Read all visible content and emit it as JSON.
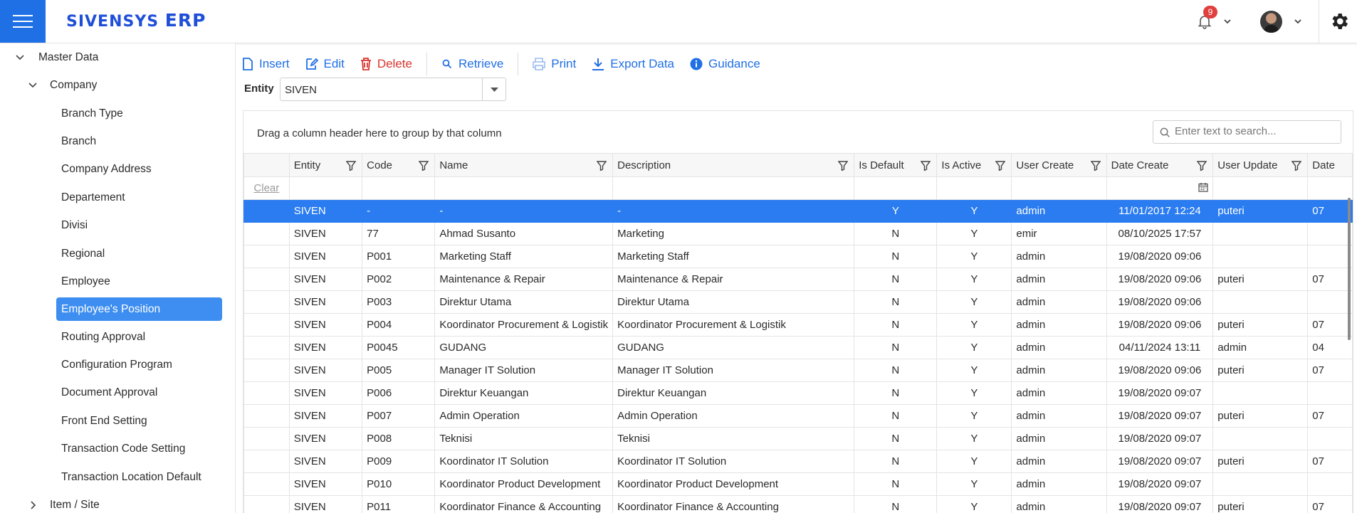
{
  "app": {
    "brand_main": "SIVENSYS",
    "brand_suffix": "ERP",
    "notification_count": "9"
  },
  "sidebar": {
    "items": [
      {
        "label": "Master Data",
        "level": 0,
        "expanded": true
      },
      {
        "label": "Company",
        "level": 1,
        "expanded": true
      },
      {
        "label": "Branch Type",
        "level": 2
      },
      {
        "label": "Branch",
        "level": 2
      },
      {
        "label": "Company Address",
        "level": 2
      },
      {
        "label": "Departement",
        "level": 2
      },
      {
        "label": "Divisi",
        "level": 2
      },
      {
        "label": "Regional",
        "level": 2
      },
      {
        "label": "Employee",
        "level": 2
      },
      {
        "label": "Employee's Position",
        "level": 2,
        "active": true
      },
      {
        "label": "Routing Approval",
        "level": 2
      },
      {
        "label": "Configuration Program",
        "level": 2
      },
      {
        "label": "Document Approval",
        "level": 2
      },
      {
        "label": "Front End Setting",
        "level": 2
      },
      {
        "label": "Transaction Code Setting",
        "level": 2
      },
      {
        "label": "Transaction Location Default",
        "level": 2
      },
      {
        "label": "Item / Site",
        "level": 1,
        "expanded": false
      }
    ]
  },
  "toolbar": {
    "insert": "Insert",
    "edit": "Edit",
    "delete": "Delete",
    "retrieve": "Retrieve",
    "print": "Print",
    "export": "Export Data",
    "guidance": "Guidance"
  },
  "entity": {
    "label": "Entity",
    "value": "SIVEN"
  },
  "grid": {
    "group_hint": "Drag a column header here to group by that column",
    "search_placeholder": "Enter text to search...",
    "clear_label": "Clear",
    "columns": [
      "Entity",
      "Code",
      "Name",
      "Description",
      "Is Default",
      "Is Active",
      "User Create",
      "Date Create",
      "User Update",
      "Date"
    ],
    "rows": [
      [
        "SIVEN",
        "-",
        "-",
        "-",
        "Y",
        "Y",
        "admin",
        "11/01/2017 12:24",
        "puteri",
        "07"
      ],
      [
        "SIVEN",
        "77",
        "Ahmad Susanto",
        "Marketing",
        "N",
        "Y",
        "emir",
        "08/10/2025 17:57",
        "",
        ""
      ],
      [
        "SIVEN",
        "P001",
        "Marketing Staff",
        "Marketing Staff",
        "N",
        "Y",
        "admin",
        "19/08/2020 09:06",
        "",
        ""
      ],
      [
        "SIVEN",
        "P002",
        "Maintenance & Repair",
        "Maintenance & Repair",
        "N",
        "Y",
        "admin",
        "19/08/2020 09:06",
        "puteri",
        "07"
      ],
      [
        "SIVEN",
        "P003",
        "Direktur Utama",
        "Direktur Utama",
        "N",
        "Y",
        "admin",
        "19/08/2020 09:06",
        "",
        ""
      ],
      [
        "SIVEN",
        "P004",
        "Koordinator Procurement & Logistik",
        "Koordinator Procurement & Logistik",
        "N",
        "Y",
        "admin",
        "19/08/2020 09:06",
        "puteri",
        "07"
      ],
      [
        "SIVEN",
        "P0045",
        "GUDANG",
        "GUDANG",
        "N",
        "Y",
        "admin",
        "04/11/2024 13:11",
        "admin",
        "04"
      ],
      [
        "SIVEN",
        "P005",
        "Manager IT Solution",
        "Manager IT Solution",
        "N",
        "Y",
        "admin",
        "19/08/2020 09:06",
        "puteri",
        "07"
      ],
      [
        "SIVEN",
        "P006",
        "Direktur Keuangan",
        "Direktur Keuangan",
        "N",
        "Y",
        "admin",
        "19/08/2020 09:07",
        "",
        ""
      ],
      [
        "SIVEN",
        "P007",
        "Admin Operation",
        "Admin Operation",
        "N",
        "Y",
        "admin",
        "19/08/2020 09:07",
        "puteri",
        "07"
      ],
      [
        "SIVEN",
        "P008",
        "Teknisi",
        "Teknisi",
        "N",
        "Y",
        "admin",
        "19/08/2020 09:07",
        "",
        ""
      ],
      [
        "SIVEN",
        "P009",
        "Koordinator IT Solution",
        "Koordinator IT Solution",
        "N",
        "Y",
        "admin",
        "19/08/2020 09:07",
        "puteri",
        "07"
      ],
      [
        "SIVEN",
        "P010",
        "Koordinator Product Development",
        "Koordinator Product Development",
        "N",
        "Y",
        "admin",
        "19/08/2020 09:07",
        "",
        ""
      ],
      [
        "SIVEN",
        "P011",
        "Koordinator Finance & Accounting",
        "Koordinator Finance & Accounting",
        "N",
        "Y",
        "admin",
        "19/08/2020 09:07",
        "puteri",
        "07"
      ]
    ]
  },
  "colors": {
    "accent": "#1f6fe5",
    "selected_row": "#2a7cf0",
    "danger": "#d9332e"
  }
}
